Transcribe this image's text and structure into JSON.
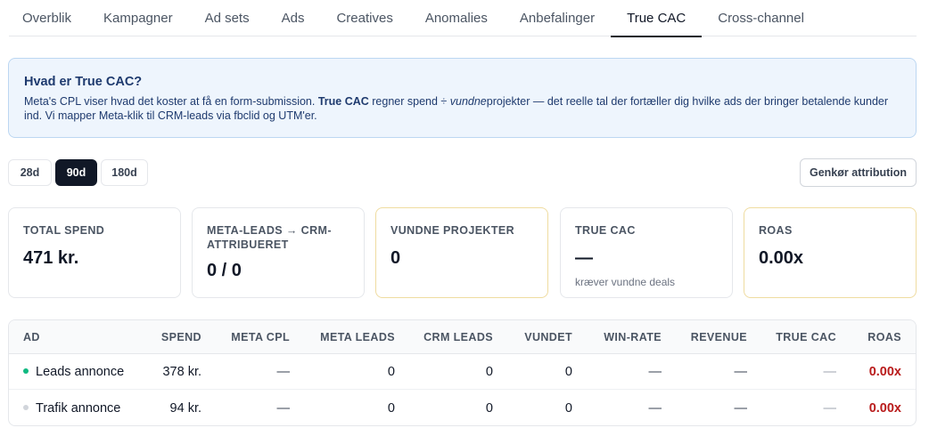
{
  "tabs": [
    {
      "label": "Overblik"
    },
    {
      "label": "Kampagner"
    },
    {
      "label": "Ad sets"
    },
    {
      "label": "Ads"
    },
    {
      "label": "Creatives"
    },
    {
      "label": "Anomalies"
    },
    {
      "label": "Anbefalinger"
    },
    {
      "label": "True CAC",
      "active": true
    },
    {
      "label": "Cross-channel"
    }
  ],
  "info": {
    "title": "Hvad er True CAC?",
    "text_1": "Meta's CPL viser hvad det koster at få en form-submission. ",
    "text_bold": "True CAC",
    "text_2": " regner spend ÷ ",
    "text_italic": "vundne",
    "text_3": "projekter — det reelle tal der fortæller dig hvilke ads der bringer betalende kunder ind. Vi mapper Meta-klik til CRM-leads via fbclid og UTM'er."
  },
  "range": {
    "options": [
      "28d",
      "90d",
      "180d"
    ],
    "selected": "90d"
  },
  "rerun_button": "Genkør attribution",
  "cards": [
    {
      "label": "TOTAL SPEND",
      "value": "471 kr.",
      "sub": ""
    },
    {
      "label": "META-LEADS → CRM-ATTRIBUERET",
      "value": "0 / 0",
      "sub": ""
    },
    {
      "label": "VUNDNE PROJEKTER",
      "value": "0",
      "sub": ""
    },
    {
      "label": "TRUE CAC",
      "value": "—",
      "sub": "kræver vundne deals"
    },
    {
      "label": "ROAS",
      "value": "0.00x",
      "sub": ""
    }
  ],
  "table": {
    "columns": [
      "AD",
      "SPEND",
      "META CPL",
      "META LEADS",
      "CRM LEADS",
      "VUNDET",
      "WIN-RATE",
      "REVENUE",
      "TRUE CAC",
      "ROAS"
    ],
    "rows": [
      {
        "ad": "Leads annonce",
        "dot_color": "#10b981",
        "spend": "378 kr.",
        "meta_cpl": "—",
        "meta_leads": "0",
        "crm_leads": "0",
        "vundet": "0",
        "win_rate": "—",
        "revenue": "—",
        "true_cac": "—",
        "roas": "0.00x"
      },
      {
        "ad": "Trafik annonce",
        "dot_color": "#d1d5db",
        "spend": "94 kr.",
        "meta_cpl": "—",
        "meta_leads": "0",
        "crm_leads": "0",
        "vundet": "0",
        "win_rate": "—",
        "revenue": "—",
        "true_cac": "—",
        "roas": "0.00x"
      }
    ]
  },
  "colors": {
    "accent": "#111827",
    "info_bg": "#eef5fd",
    "highlight_border": "#efdca0",
    "roas_negative": "#b91c1c"
  }
}
